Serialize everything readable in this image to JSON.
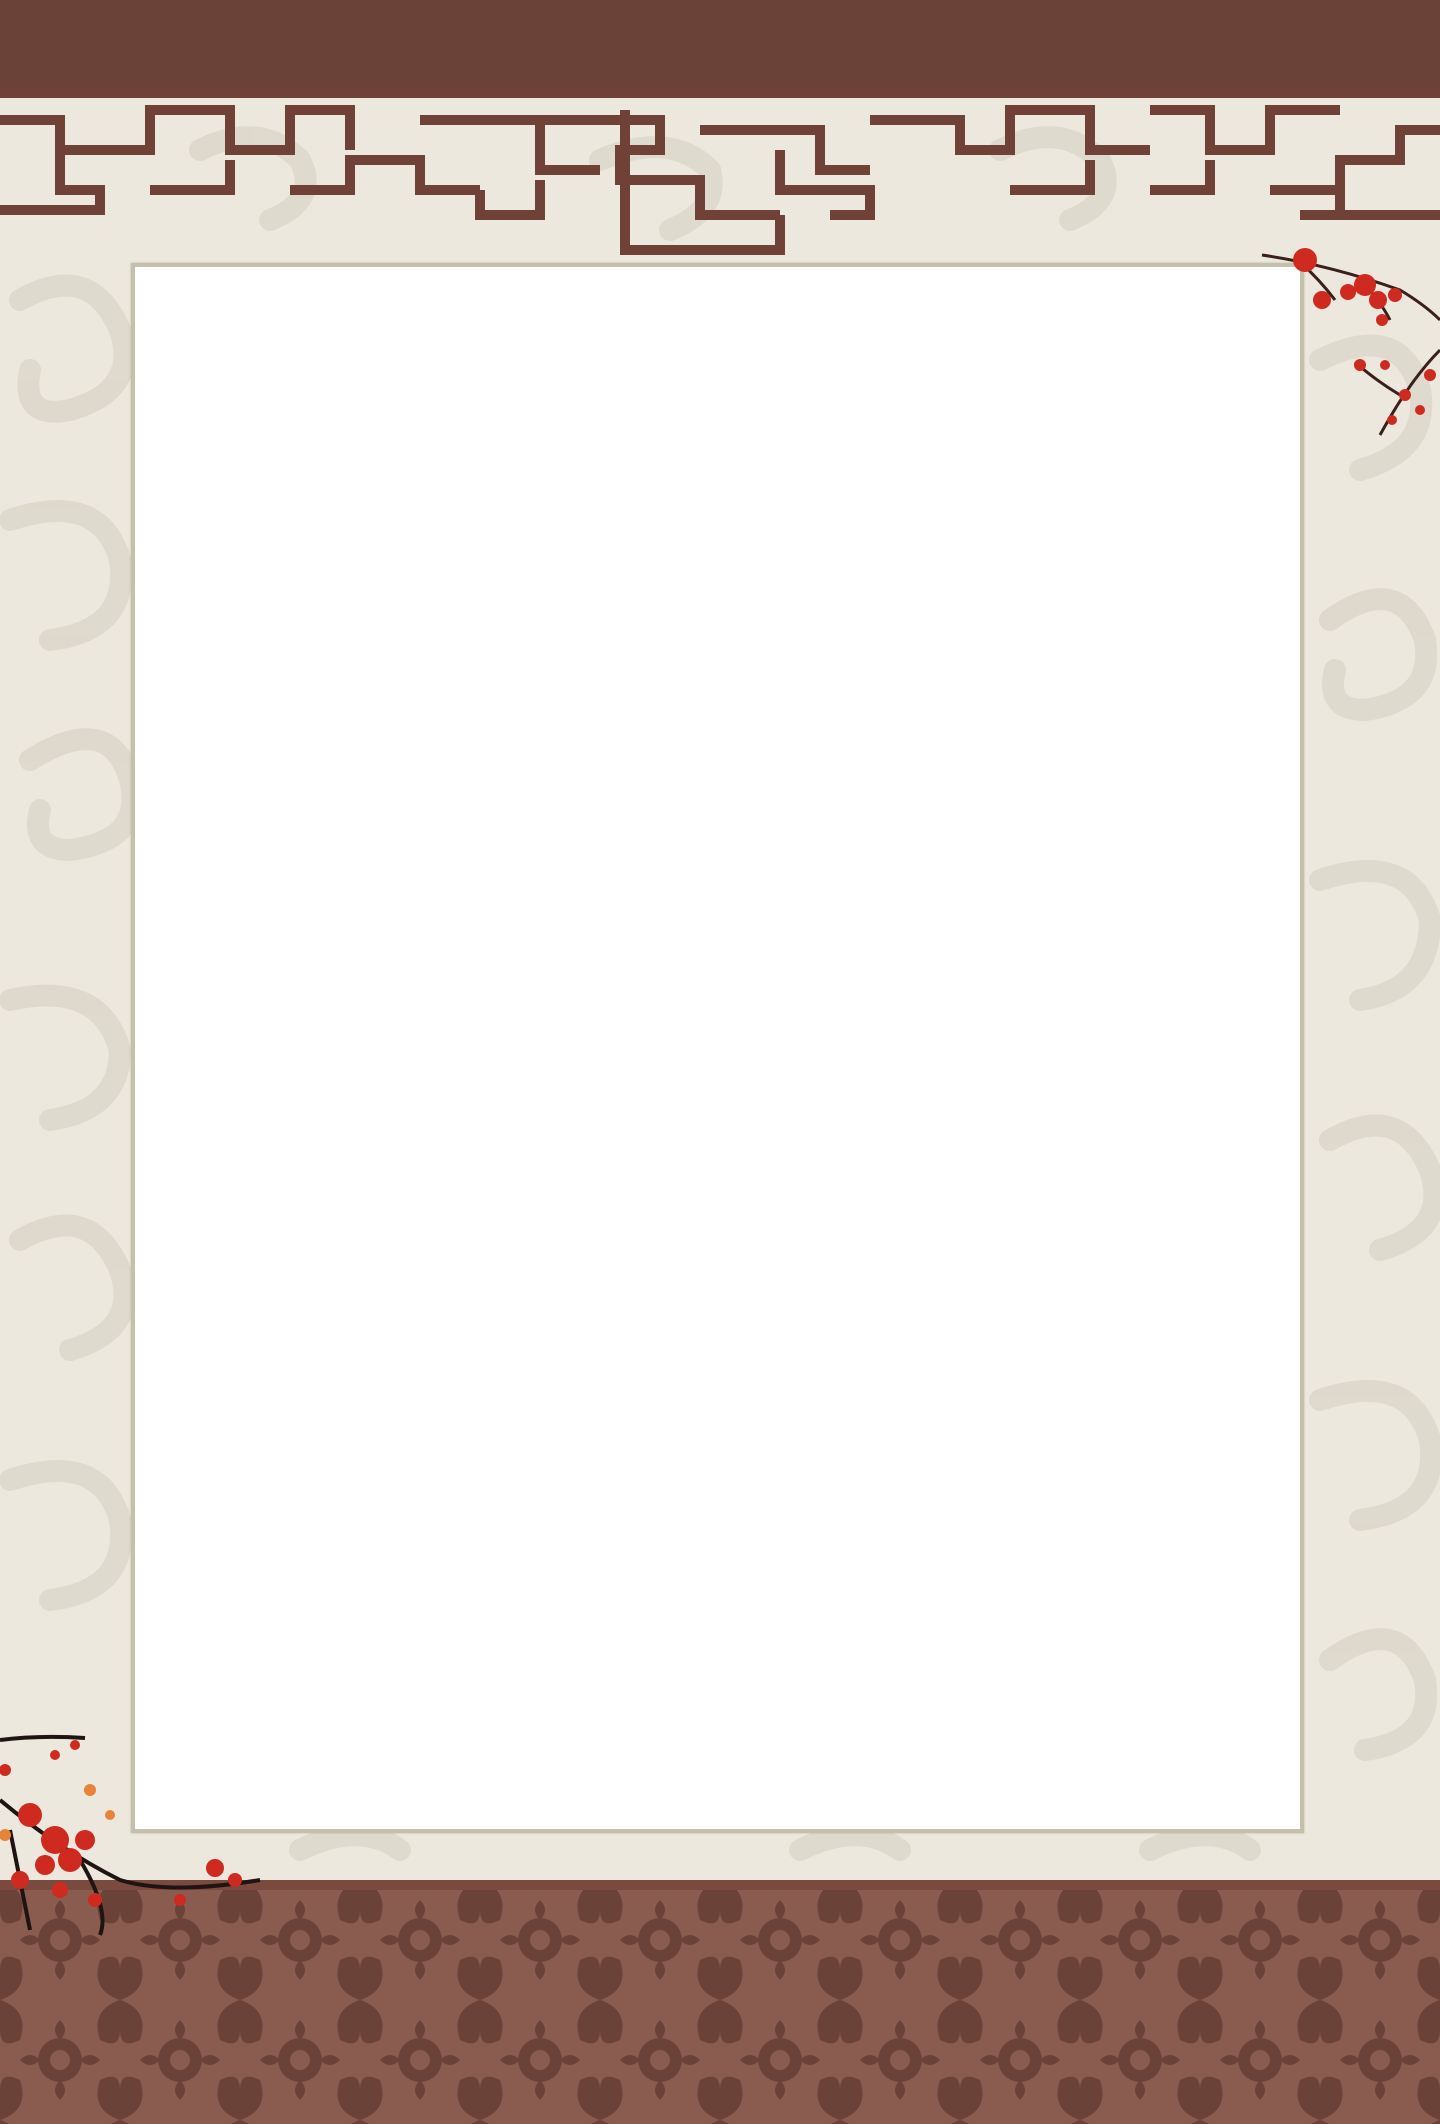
{
  "colors": {
    "background": "#ece8de",
    "swirl_pattern": "#dcd7ca",
    "header_band": "#6b4238",
    "lattice": "#6f4137",
    "paper": "#ffffff",
    "paper_border": "#c4c0ac",
    "footer_band": "#8a5b4f",
    "footer_pattern": "#6b4238",
    "blossom": "#cf2a1f",
    "branch": "#3a1f1a"
  },
  "decorations": {
    "top_right": "plum-blossom-branch",
    "bottom_left": "plum-blossom-branch",
    "header": "chinese-lattice-border",
    "footer": "floral-damask-pattern"
  }
}
